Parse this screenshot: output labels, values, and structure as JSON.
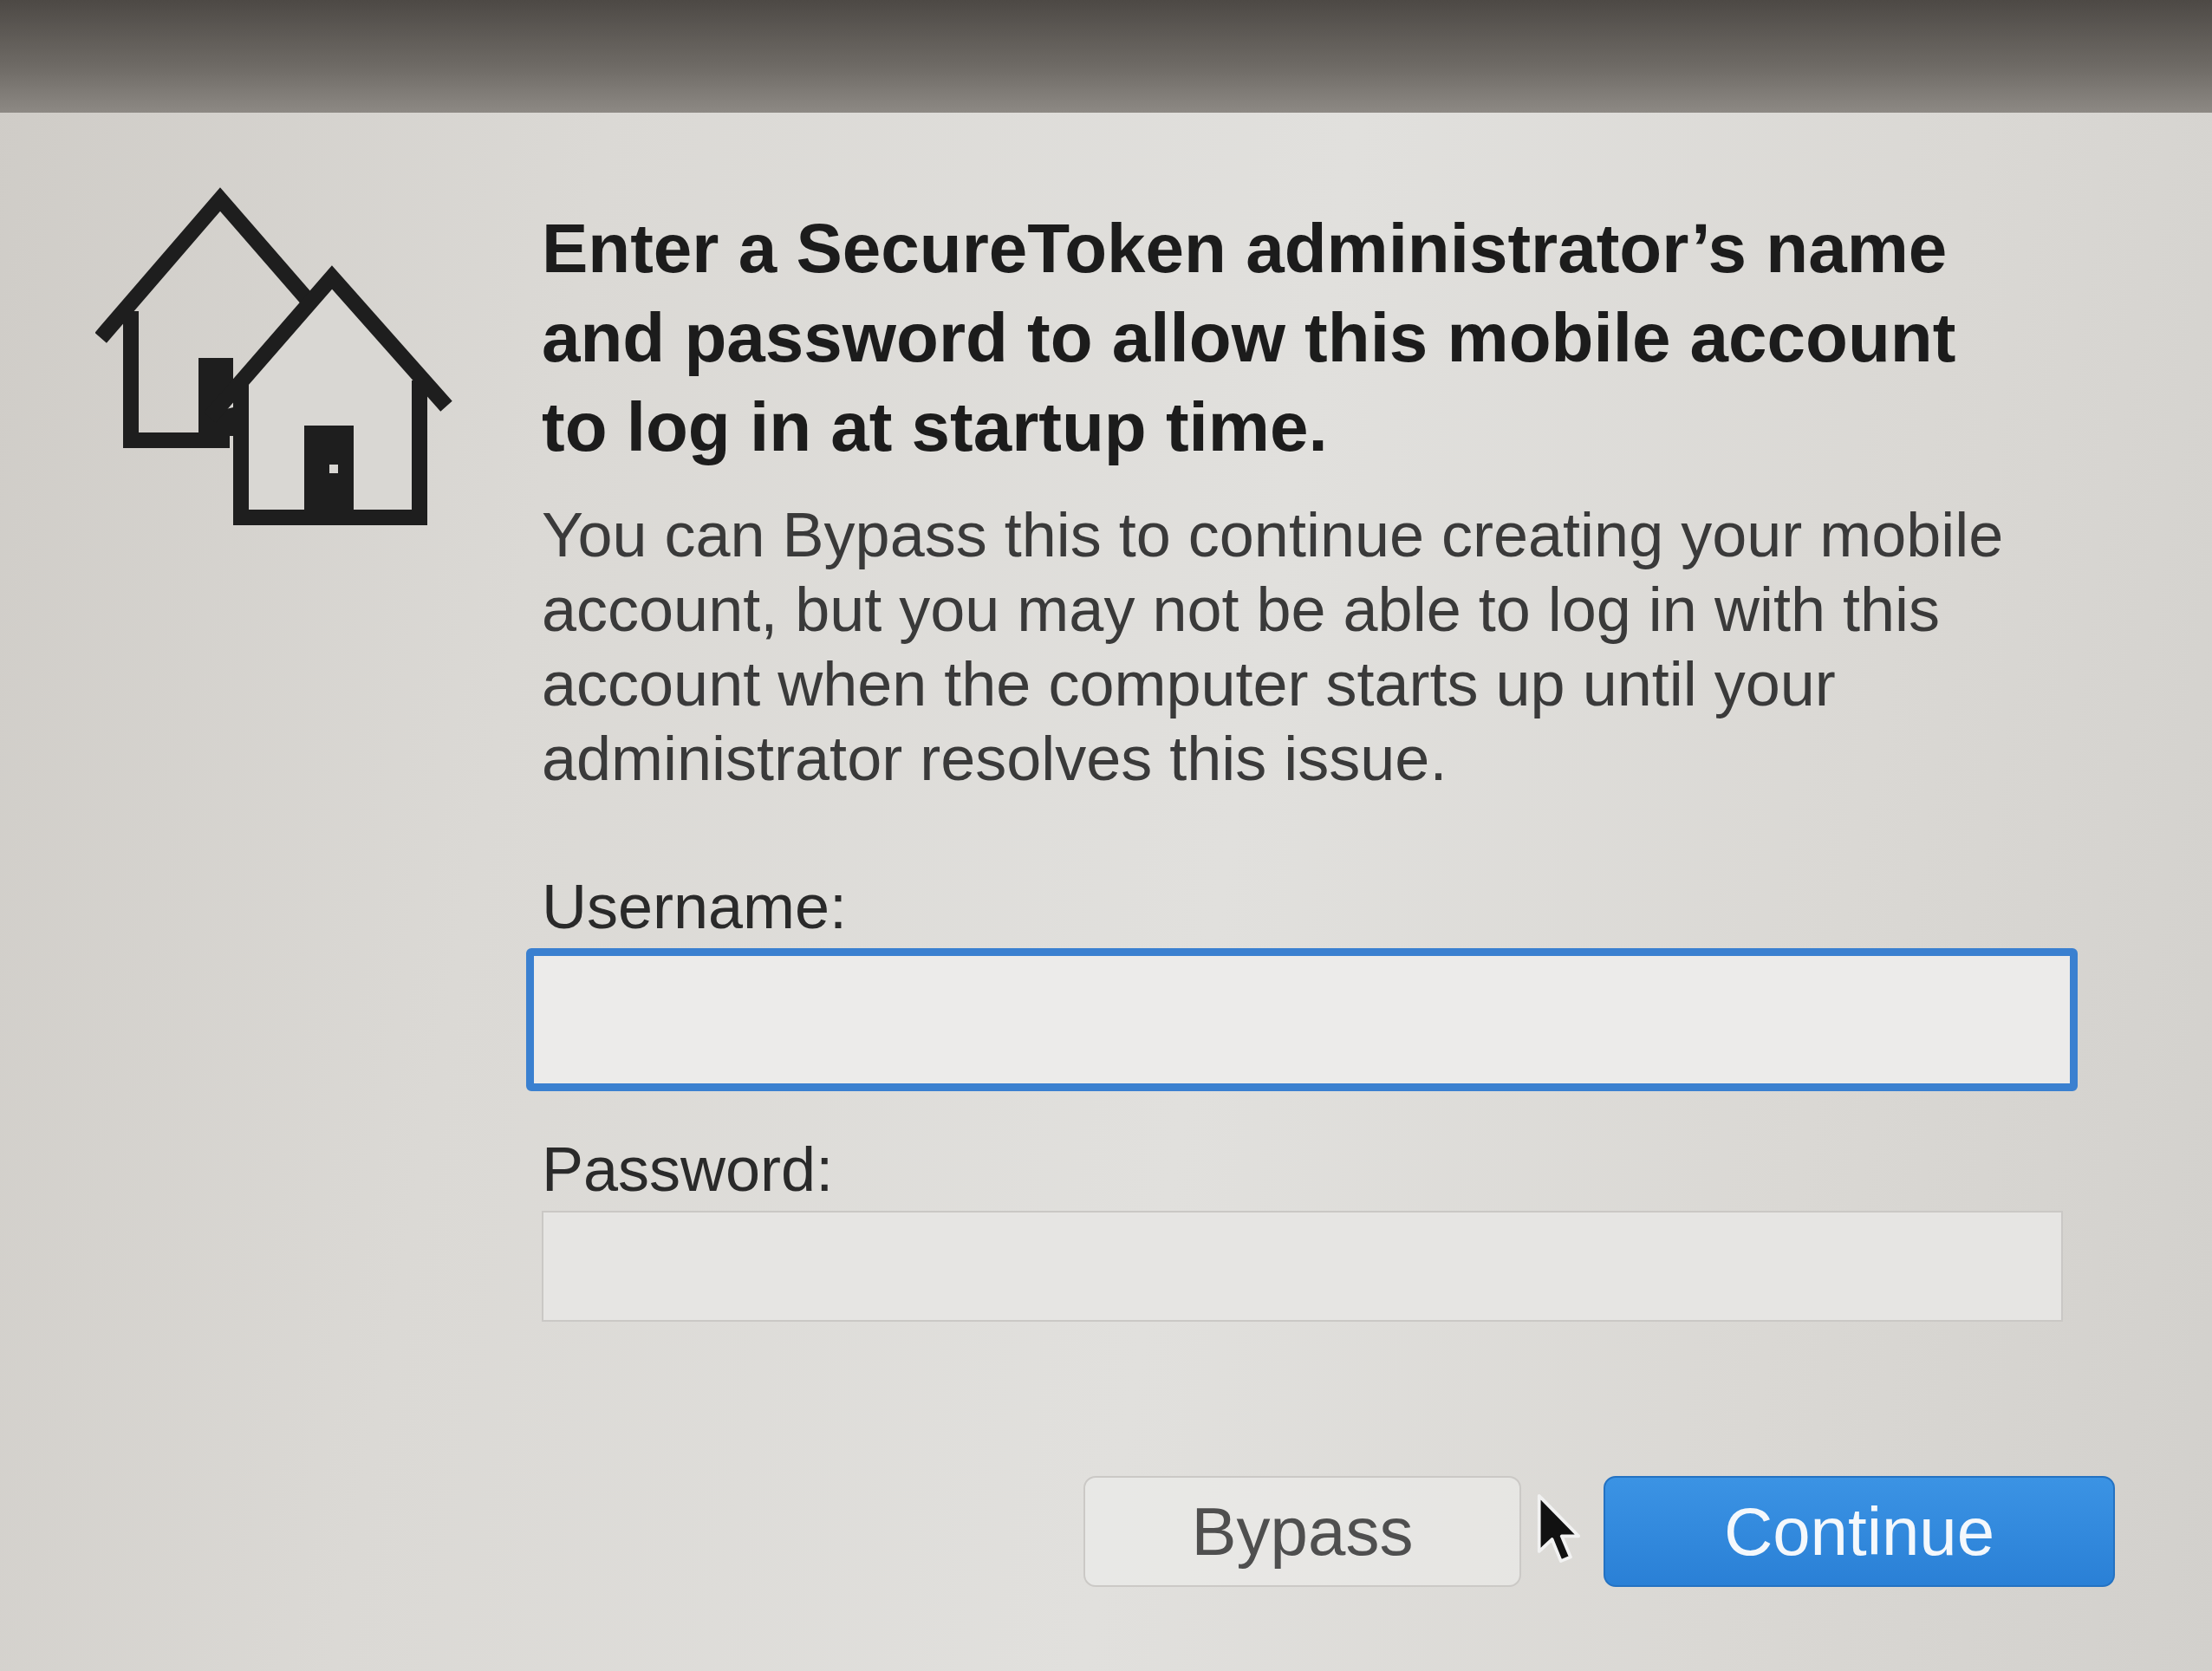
{
  "heading": "Enter a SecureToken administrator’s name and password to allow this mobile account to log in at startup time.",
  "message": "You can Bypass this to continue creating your mobile account, but you may not be able to log in with this account when the computer starts up until your administrator resolves this issue.",
  "fields": [
    {
      "label": "Username:",
      "focused": true
    },
    {
      "label": "Password:",
      "focused": false
    }
  ],
  "buttons": [
    {
      "label": "Bypass",
      "kind": "secondary"
    },
    {
      "label": "Continue",
      "kind": "primary"
    }
  ]
}
